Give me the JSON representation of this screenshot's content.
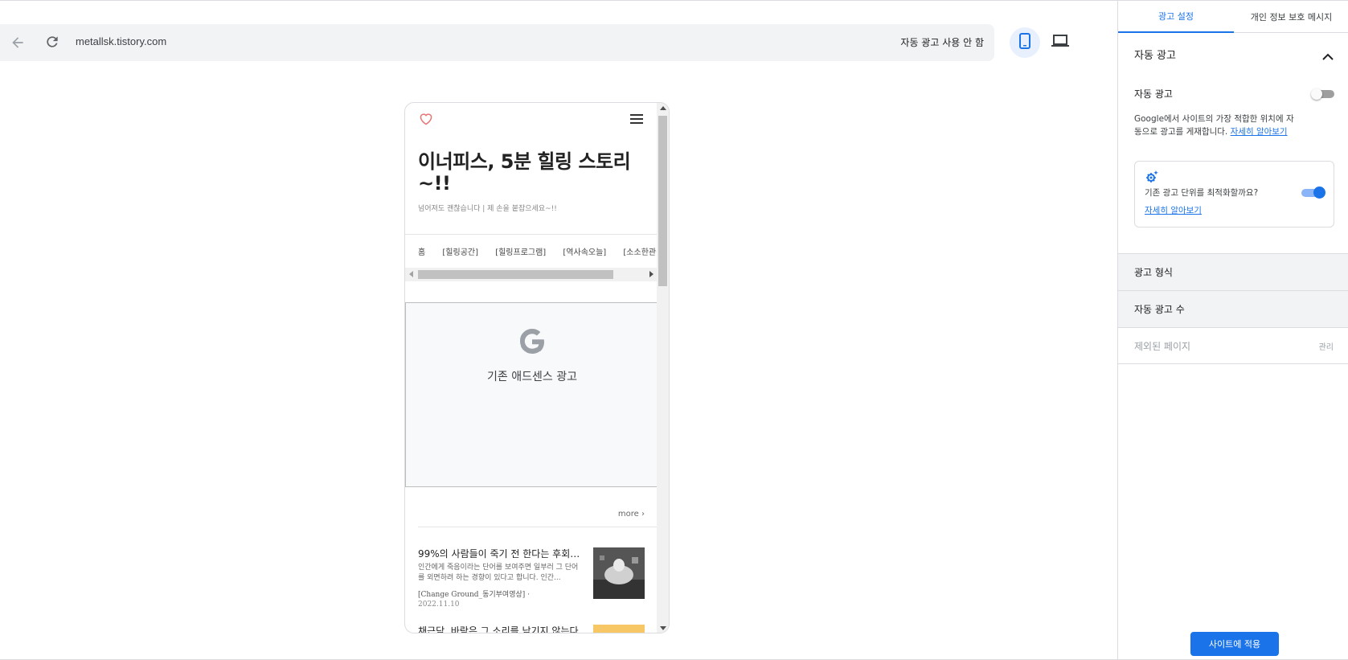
{
  "browser": {
    "url": "metallsk.tistory.com",
    "auto_ads_status": "자동 광고 사용 안 함",
    "back_icon": "arrow-back-icon",
    "reload_icon": "reload-icon",
    "device_mobile_icon": "smartphone-icon",
    "device_desktop_icon": "laptop-icon"
  },
  "preview": {
    "blog_title": "이너피스, 5분 힐링 스토리~!!",
    "blog_subtitle": "넘어져도 괜찮습니다  |  제 손을 붙잡으세요~!!",
    "nav_items": [
      "홈",
      "[힐링공간]",
      "[힐링프로그램]",
      "[역사속오늘]",
      "[소소한관심"
    ],
    "ad_label": "기존 애드센스 광고",
    "more_label": "more ›",
    "posts": [
      {
        "title": "99%의 사람들이 죽기 전 한다는 후회, ...",
        "excerpt": "인간에게 죽음이라는 단어를 보여주면 일부러 그 단어를 외면하려 하는 경향이 있다고 합니다. 인간...",
        "category": "[Change Ground_동기부여영상] ·",
        "date": "2022.11.10"
      },
      {
        "title": "채근담, 바람은 그 소리를 남기지 않는다"
      }
    ]
  },
  "panel": {
    "tabs": [
      {
        "label": "광고 설정",
        "active": true
      },
      {
        "label": "개인 정보 보호 메시지",
        "active": false
      }
    ],
    "section_title": "자동 광고",
    "auto_ads_label": "자동 광고",
    "auto_ads_enabled": false,
    "description": "Google에서 사이트의 가장 적합한 위치에 자동으로 광고를 게재합니다. ",
    "learn_more": "자세히 알아보기",
    "optimize_text": "기존 광고 단위를 최적화할까요?",
    "optimize_enabled": true,
    "optimize_link": "자세히 알아보기",
    "ad_format": "광고 형식",
    "ad_count": "자동 광고 수",
    "excluded_pages": "제외된 페이지",
    "manage": "관리",
    "apply_button": "사이트에 적용"
  },
  "colors": {
    "accent": "#1a73e8",
    "heart": "#e57373"
  }
}
